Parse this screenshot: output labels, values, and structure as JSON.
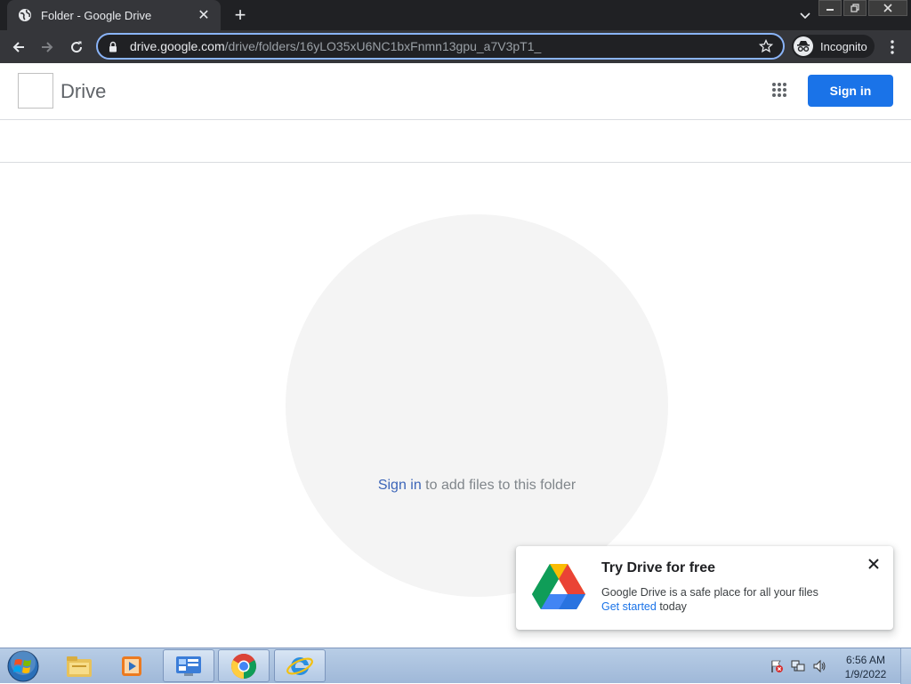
{
  "browser": {
    "tab_title": "Folder - Google Drive",
    "tab_close": "✕",
    "new_tab": "+",
    "url_host": "drive.google.com",
    "url_path": "/drive/folders/16yLO35xU6NC1bxFnmn13gpu_a7V3pT1_",
    "incognito_label": "Incognito"
  },
  "drive": {
    "title": "Drive",
    "sign_in_button": "Sign in"
  },
  "empty_state": {
    "link": "Sign in",
    "text": " to add files to this folder"
  },
  "promo": {
    "title": "Try Drive for free",
    "line1": "Google Drive is a safe place for all your files",
    "link": "Get started",
    "line2_rest": " today"
  },
  "taskbar": {
    "time": "6:56 AM",
    "date": "1/9/2022"
  },
  "colors": {
    "accent": "#1a73e8",
    "chrome_dark": "#202124",
    "omnibox_focus": "#8ab4f8"
  }
}
